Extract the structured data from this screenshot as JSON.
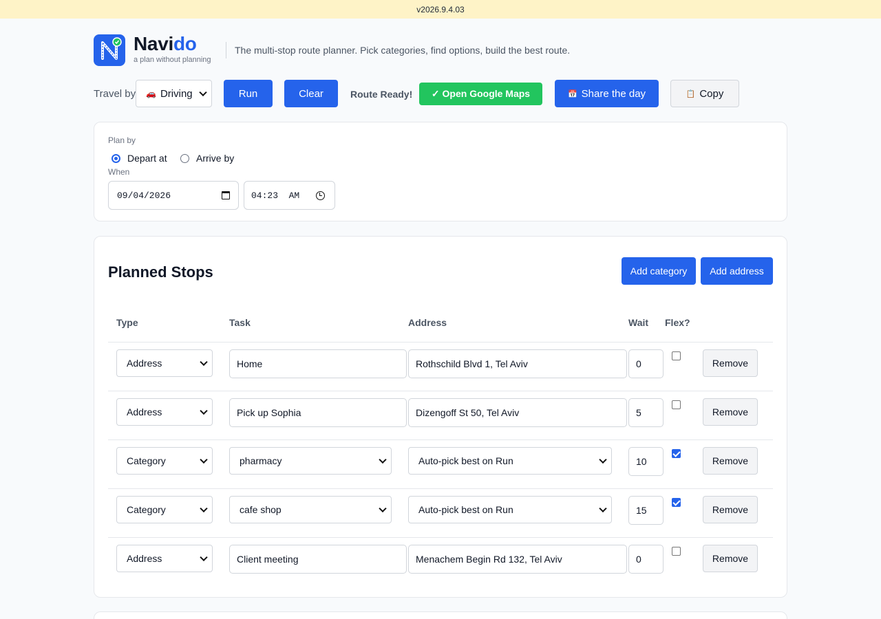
{
  "version": "v2026.9.4.03",
  "header": {
    "brand_part1": "Navi",
    "brand_part2": "do",
    "subtitle": "a plan without planning",
    "tagline": "The multi-stop route planner. Pick categories, find options, build the best route."
  },
  "toolbar": {
    "travel_label": "Travel by",
    "travel_mode": "Driving",
    "run_label": "Run",
    "clear_label": "Clear",
    "status": "Route Ready!",
    "gmaps_label": "✓ Open Google Maps",
    "share_label": "Share the day",
    "copy_label": "Copy"
  },
  "plan": {
    "plan_by_label": "Plan by",
    "depart_label": "Depart at",
    "arrive_label": "Arrive by",
    "selected": "depart",
    "when_label": "When",
    "date": "09/04/2026",
    "time": "04:23  AM"
  },
  "stops": {
    "title": "Planned Stops",
    "add_category_label": "Add category",
    "add_address_label": "Add address",
    "headers": {
      "type": "Type",
      "task": "Task",
      "address": "Address",
      "wait": "Wait",
      "flex": "Flex?"
    },
    "remove_label": "Remove",
    "rows": [
      {
        "type": "Address",
        "task": "Home",
        "address": "Rothschild Blvd 1, Tel Aviv",
        "wait": "0",
        "flex": false
      },
      {
        "type": "Address",
        "task": "Pick up Sophia",
        "address": "Dizengoff St 50, Tel Aviv",
        "wait": "5",
        "flex": false
      },
      {
        "type": "Category",
        "task": "pharmacy",
        "address": "Auto-pick best on Run",
        "wait": "10",
        "flex": true
      },
      {
        "type": "Category",
        "task": "cafe shop",
        "address": "Auto-pick best on Run",
        "wait": "15",
        "flex": true
      },
      {
        "type": "Address",
        "task": "Client meeting",
        "address": "Menachem Begin Rd 132, Tel Aviv",
        "wait": "0",
        "flex": false
      }
    ]
  },
  "colors": {
    "accent": "#2563eb",
    "success": "#22c55e",
    "banner": "#fef3c7"
  }
}
